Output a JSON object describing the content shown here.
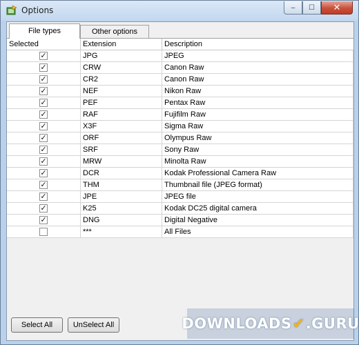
{
  "window": {
    "title": "Options",
    "close_symbol": "✕",
    "min_symbol": "–",
    "max_symbol": "☐"
  },
  "tabs": [
    {
      "label": "File types",
      "active": true
    },
    {
      "label": "Other options",
      "active": false
    }
  ],
  "grid": {
    "columns": [
      "Selected",
      "Extension",
      "Description"
    ],
    "rows": [
      {
        "selected": true,
        "extension": "JPG",
        "description": "JPEG"
      },
      {
        "selected": true,
        "extension": "CRW",
        "description": "Canon Raw"
      },
      {
        "selected": true,
        "extension": "CR2",
        "description": "Canon Raw"
      },
      {
        "selected": true,
        "extension": "NEF",
        "description": "Nikon Raw"
      },
      {
        "selected": true,
        "extension": "PEF",
        "description": "Pentax Raw"
      },
      {
        "selected": true,
        "extension": "RAF",
        "description": "Fujifilm Raw"
      },
      {
        "selected": true,
        "extension": "X3F",
        "description": "Sigma Raw"
      },
      {
        "selected": true,
        "extension": "ORF",
        "description": "Olympus Raw"
      },
      {
        "selected": true,
        "extension": "SRF",
        "description": "Sony Raw"
      },
      {
        "selected": true,
        "extension": "MRW",
        "description": "Minolta Raw"
      },
      {
        "selected": true,
        "extension": "DCR",
        "description": "Kodak Professional Camera Raw"
      },
      {
        "selected": true,
        "extension": "THM",
        "description": "Thumbnail file (JPEG format)"
      },
      {
        "selected": true,
        "extension": "JPE",
        "description": "JPEG file"
      },
      {
        "selected": true,
        "extension": "K25",
        "description": "Kodak DC25 digital camera"
      },
      {
        "selected": true,
        "extension": "DNG",
        "description": "Digital Negative"
      },
      {
        "selected": false,
        "extension": "***",
        "description": "All Files"
      }
    ]
  },
  "buttons": {
    "select_all": "Select All",
    "unselect_all": "UnSelect All"
  },
  "watermark": {
    "text_left": "DOWNLOADS",
    "text_right": ".GURU",
    "check": "✔"
  },
  "colors": {
    "frame": "#b9d1ea",
    "close_button": "#c7503a",
    "watermark_check": "#f2b21b"
  }
}
